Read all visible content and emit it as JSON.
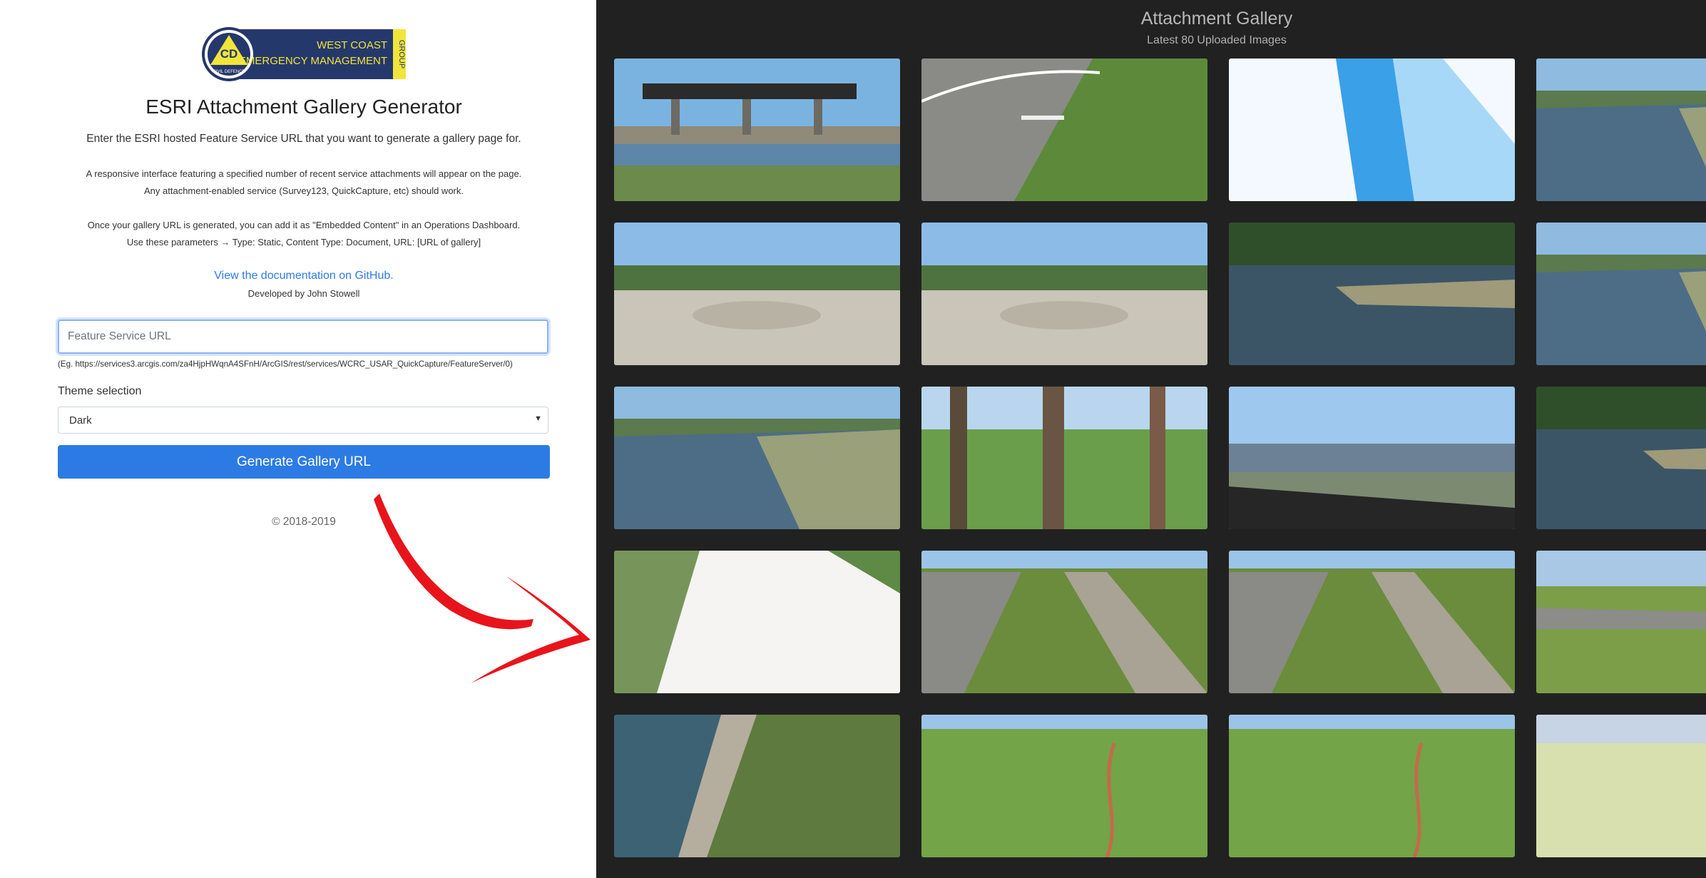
{
  "logo": {
    "badge": "CD",
    "badge_ring": "CIVIL DEFENCE",
    "line1": "WEST COAST",
    "line2": "EMERGENCY MANAGEMENT",
    "side": "GROUP"
  },
  "generator": {
    "title": "ESRI Attachment Gallery Generator",
    "intro": "Enter the ESRI hosted Feature Service URL that you want to generate a gallery page for.",
    "desc_line1": "A responsive interface featuring a specified number of recent service attachments will appear on the page.",
    "desc_line2": "Any attachment-enabled service (Survey123, QuickCapture, etc) should work.",
    "desc_line3": "Once your gallery URL is generated, you can add it as \"Embedded Content\" in an Operations Dashboard.",
    "desc_line4": "Use these parameters → Type: Static, Content Type: Document, URL: [URL of gallery]",
    "doc_link": "View the documentation on GitHub.",
    "developer": "Developed by John Stowell",
    "url_placeholder": "Feature Service URL",
    "url_value": "",
    "example": "(Eg. https://services3.arcgis.com/za4HjpHWqnA4SFnH/ArcGIS/rest/services/WCRC_USAR_QuickCapture/FeatureServer/0)",
    "theme_label": "Theme selection",
    "theme_value": "Dark",
    "button_label": "Generate Gallery URL",
    "copyright": "© 2018-2019"
  },
  "gallery": {
    "title": "Attachment Gallery",
    "subtitle": "Latest 80 Uploaded Images",
    "images": [
      {
        "scene": "rail-bridge"
      },
      {
        "scene": "road"
      },
      {
        "scene": "overexposed-bridge"
      },
      {
        "scene": "river-bank"
      },
      {
        "scene": "gravel-riverbed"
      },
      {
        "scene": "gravel-riverbed"
      },
      {
        "scene": "river"
      },
      {
        "scene": "river-bank"
      },
      {
        "scene": "river-bank"
      },
      {
        "scene": "forest"
      },
      {
        "scene": "windshield"
      },
      {
        "scene": "river"
      },
      {
        "scene": "bright-path"
      },
      {
        "scene": "road-grass"
      },
      {
        "scene": "road-grass"
      },
      {
        "scene": "grass-road"
      },
      {
        "scene": "rapids"
      },
      {
        "scene": "grass-field"
      },
      {
        "scene": "grass-field"
      },
      {
        "scene": "pale-field"
      }
    ]
  },
  "colors": {
    "accent": "#2c7be5",
    "gallery_bg": "#212121",
    "arrow": "#e8141b",
    "logo_navy": "#25386b",
    "logo_yellow": "#f2e53a"
  }
}
